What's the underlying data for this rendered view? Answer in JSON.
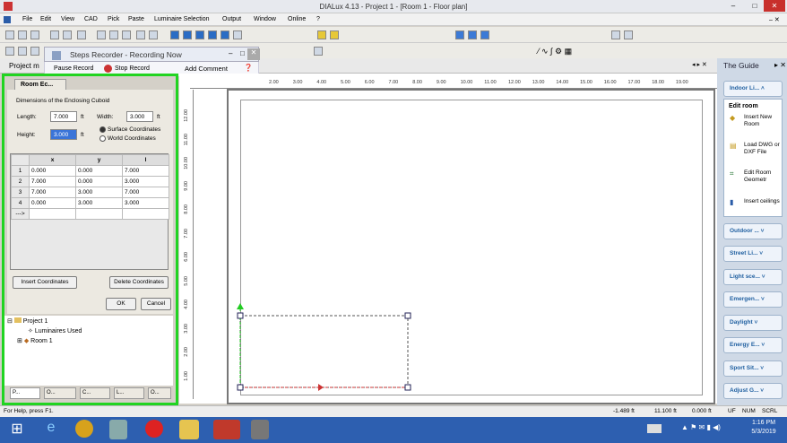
{
  "title": "DIALux 4.13 - Project 1 - [Room 1 - Floor plan]",
  "menu": [
    "File",
    "Edit",
    "View",
    "CAD",
    "Pick",
    "Paste",
    "Luminaire Selection",
    "Output",
    "Window",
    "Online",
    "?"
  ],
  "steps_recorder": {
    "title": "Steps Recorder - Recording Now",
    "pause": "Pause Record",
    "stop": "Stop Record",
    "add_comment": "Add Comment"
  },
  "project_tab": "Project m",
  "dialog": {
    "tab": "Room Ec...",
    "section": "Dimensions of the Enclosing Cuboid",
    "length_label": "Length:",
    "length_value": "7.000",
    "length_unit": "ft",
    "width_label": "Width:",
    "width_value": "3.000",
    "width_unit": "ft",
    "height_label": "Height:",
    "height_value": "3.000",
    "height_unit": "ft",
    "surface_coords": "Surface Coordinates",
    "world_coords": "World Coordinates",
    "columns": [
      "x",
      "y",
      "l"
    ],
    "rows": [
      [
        "1",
        "0.000",
        "0.000",
        "7.000"
      ],
      [
        "2",
        "7.000",
        "0.000",
        "3.000"
      ],
      [
        "3",
        "7.000",
        "3.000",
        "7.000"
      ],
      [
        "4",
        "0.000",
        "3.000",
        "3.000"
      ],
      [
        "--->",
        "",
        "",
        ""
      ]
    ],
    "insert_btn": "Insert Coordinates",
    "delete_btn": "Delete Coordinates",
    "ok": "OK",
    "cancel": "Cancel"
  },
  "tree": {
    "project": "Project 1",
    "luminaires": "Luminaires Used",
    "room": "Room 1"
  },
  "bottom_tabs": [
    "P...",
    "O...",
    "C...",
    "L...",
    "O..."
  ],
  "ruler_x": [
    "2.00",
    "3.00",
    "4.00",
    "5.00",
    "6.00",
    "7.00",
    "8.00",
    "9.00",
    "10.00",
    "11.00",
    "12.00",
    "13.00",
    "14.00",
    "15.00",
    "16.00",
    "17.00",
    "18.00",
    "19.00"
  ],
  "ruler_y": [
    "12.00",
    "11.00",
    "10.00",
    "9.00",
    "8.00",
    "7.00",
    "6.00",
    "5.00",
    "4.00",
    "3.00",
    "2.00",
    "1.00"
  ],
  "guide": {
    "title": "The Guide",
    "sections": [
      "Indoor Li...",
      "Outdoor ...",
      "Street Li...",
      "Light sce...",
      "Emergen...",
      "Daylight",
      "Energy E...",
      "Sport Sit...",
      "Adjust G..."
    ],
    "edit_room": "Edit room",
    "items": [
      "Insert New Room",
      "Load DWG or DXF File",
      "Edit Room Geometr",
      "Insert ceilings"
    ]
  },
  "status": {
    "help": "For Help, press F1.",
    "x": "-1.489 ft",
    "y": "11.100 ft",
    "z": "0.000 ft",
    "uf": "UF",
    "num": "NUM",
    "scrl": "SCRL"
  },
  "clock": {
    "time": "1:16 PM",
    "date": "5/3/2019"
  },
  "colors": {
    "highlight": "#21d421",
    "taskbar": "#2d5fb0"
  }
}
